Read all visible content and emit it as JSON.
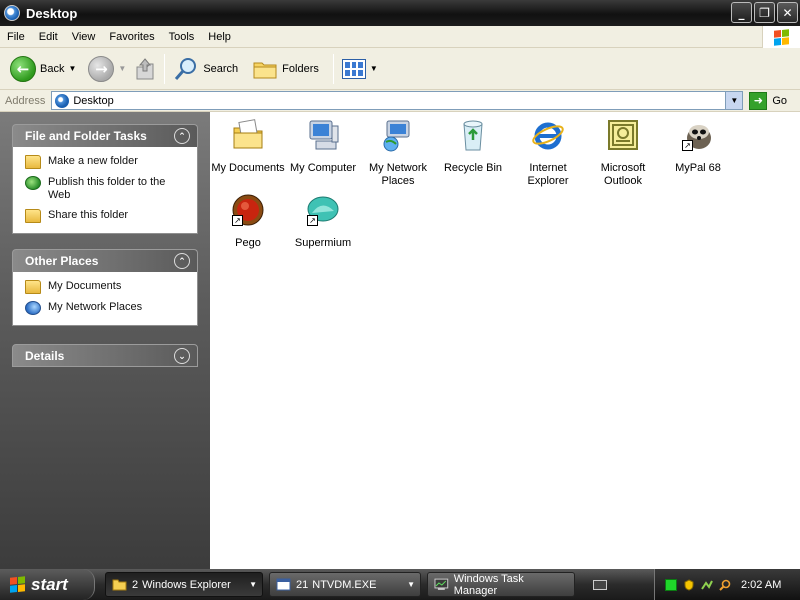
{
  "window": {
    "title": "Desktop",
    "buttons": [
      "_",
      "❐",
      "✕"
    ]
  },
  "menu": [
    "File",
    "Edit",
    "View",
    "Favorites",
    "Tools",
    "Help"
  ],
  "toolbar": {
    "back": "Back",
    "search": "Search",
    "folders": "Folders"
  },
  "address": {
    "label": "Address",
    "value": "Desktop",
    "go": "Go"
  },
  "taskpane": {
    "file_tasks": {
      "title": "File and Folder Tasks",
      "items": [
        "Make a new folder",
        "Publish this folder to the Web",
        "Share this folder"
      ]
    },
    "other_places": {
      "title": "Other Places",
      "items": [
        "My Documents",
        "My Network Places"
      ]
    },
    "details": {
      "title": "Details"
    }
  },
  "desktop_items": [
    {
      "label": "My Documents",
      "icon": "my-documents-icon"
    },
    {
      "label": "My Computer",
      "icon": "my-computer-icon"
    },
    {
      "label": "My Network Places",
      "icon": "network-places-icon"
    },
    {
      "label": "Recycle Bin",
      "icon": "recycle-bin-icon"
    },
    {
      "label": "Internet Explorer",
      "icon": "internet-explorer-icon"
    },
    {
      "label": "Microsoft Outlook",
      "icon": "outlook-icon"
    },
    {
      "label": "MyPal 68",
      "icon": "mypal-icon"
    },
    {
      "label": "Pego",
      "icon": "pego-icon"
    },
    {
      "label": "Supermium",
      "icon": "supermium-icon"
    }
  ],
  "taskbar": {
    "start": "start",
    "tasks": [
      {
        "count": "2",
        "label": "Windows Explorer"
      },
      {
        "count": "21",
        "label": "NTVDM.EXE"
      },
      {
        "label": "Windows Task Manager"
      }
    ],
    "clock": "2:02 AM"
  },
  "colors": {
    "title_bar": "#1c1c1c",
    "menu_bg": "#f1efe2",
    "task_pane": "#5d5d5d",
    "accent_green": "#2f9a1d"
  }
}
